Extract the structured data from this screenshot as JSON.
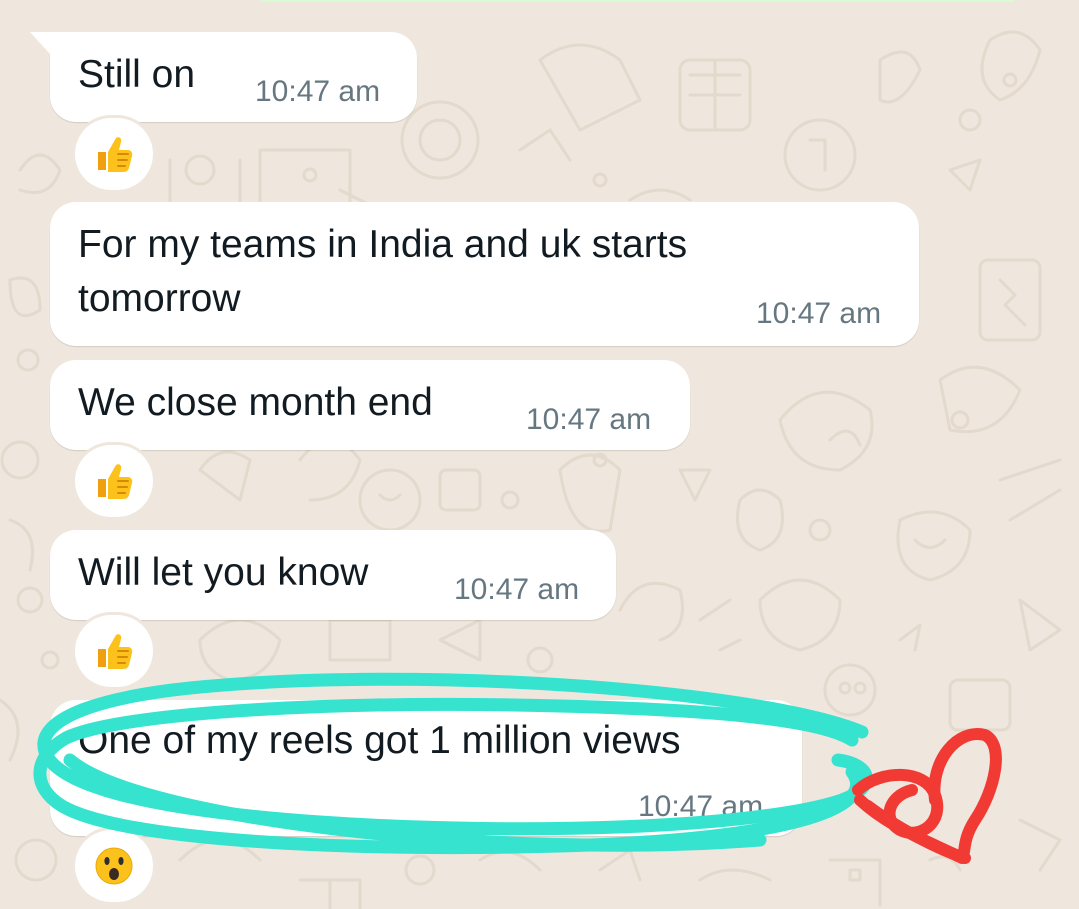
{
  "chat": {
    "messages": [
      {
        "text": "Still on",
        "time": "10:47 am",
        "reaction": "thumbs-up-icon"
      },
      {
        "text_lines": [
          "For my teams in India and uk starts",
          "tomorrow"
        ],
        "time": "10:47 am",
        "reaction": null
      },
      {
        "text": "We close month end",
        "time": "10:47 am",
        "reaction": "thumbs-up-icon"
      },
      {
        "text": "Will let you know",
        "time": "10:47 am",
        "reaction": "thumbs-up-icon"
      },
      {
        "text": "One of my reels got 1 million views",
        "time": "10:47 am",
        "reaction": "surprised-face-icon"
      }
    ]
  },
  "annotations": {
    "highlight_color": "#35e3cf",
    "heart_color": "#f23a35"
  },
  "colors": {
    "background": "#efe7dd",
    "bubble": "#ffffff",
    "text": "#111b21",
    "timestamp": "#667781"
  }
}
